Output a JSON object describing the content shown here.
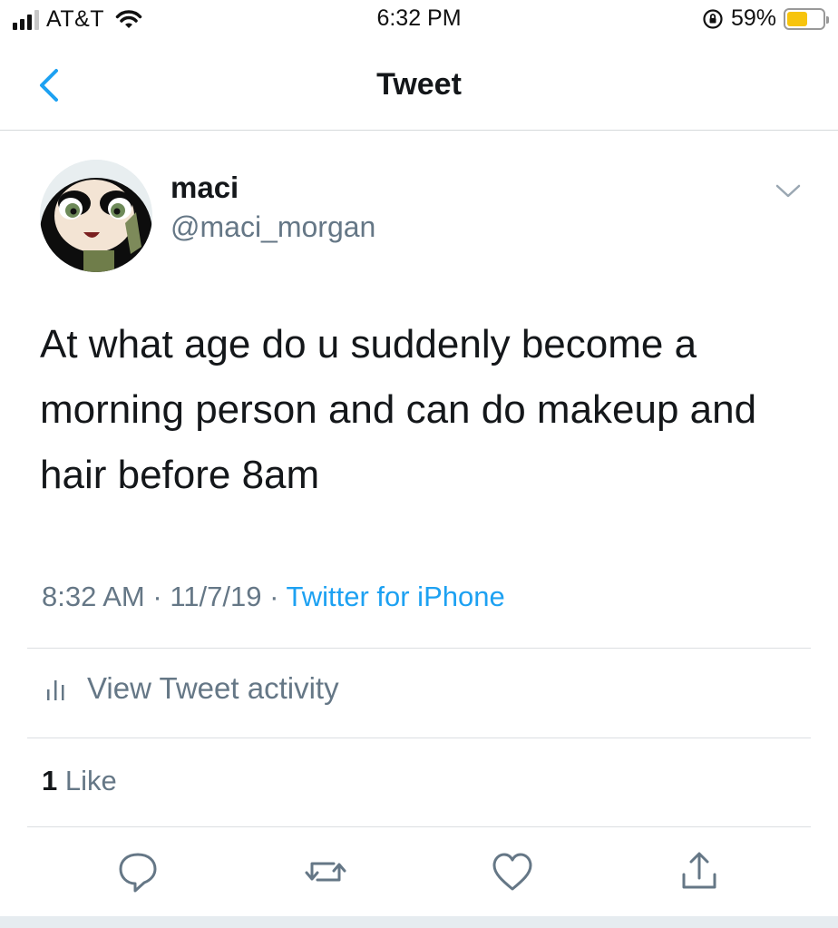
{
  "status_bar": {
    "carrier": "AT&T",
    "time": "6:32 PM",
    "battery_percent": "59%",
    "battery_level": 0.59,
    "battery_color": "#f7c40d"
  },
  "nav": {
    "title": "Tweet",
    "back_icon": "chevron-left-icon"
  },
  "author": {
    "name": "maci",
    "handle": "@maci_morgan"
  },
  "tweet": {
    "text": "At what age do u suddenly become a morning person and can do makeup and hair before 8am",
    "time": "8:32 AM",
    "separator": "·",
    "date": "11/7/19",
    "source": "Twitter for iPhone"
  },
  "activity": {
    "label": "View Tweet activity",
    "icon": "bar-chart-icon"
  },
  "stats": {
    "likes_count": "1",
    "likes_label": "Like"
  },
  "actions": [
    "reply-icon",
    "retweet-icon",
    "like-icon",
    "share-icon"
  ],
  "colors": {
    "accent": "#1da1f2",
    "secondary_text": "#657786",
    "primary_text": "#14171a"
  }
}
